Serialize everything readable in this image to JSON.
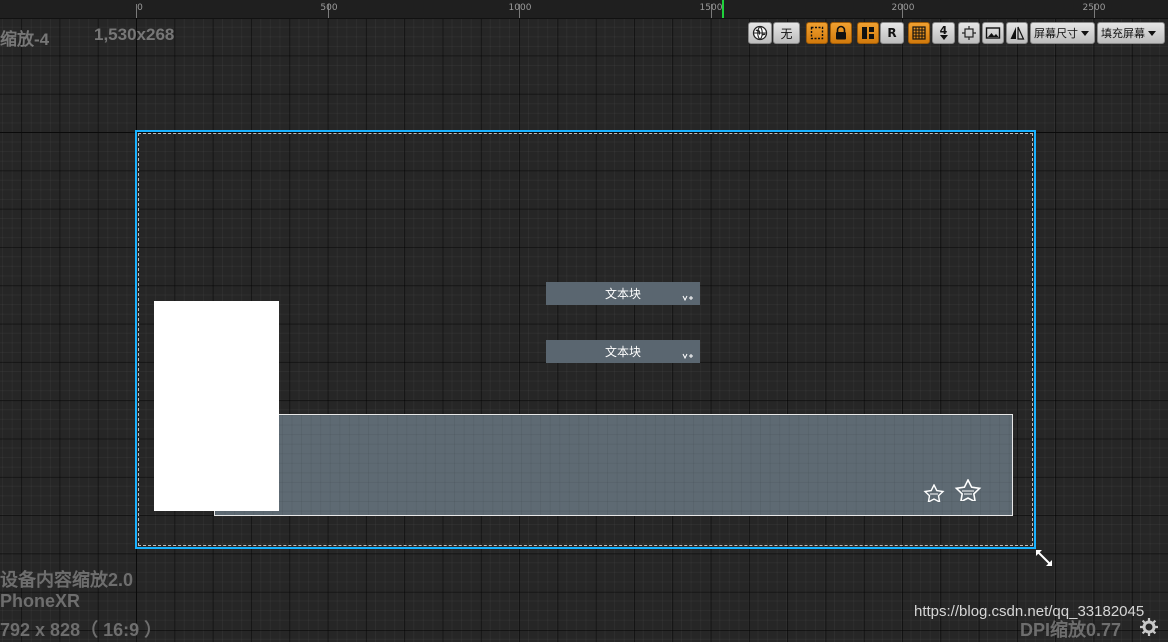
{
  "ruler": {
    "labels": [
      "0",
      "500",
      "1000",
      "1500",
      "2000",
      "2500"
    ],
    "marker_color": "#1fd13b"
  },
  "header": {
    "zoom_label": "缩放-4",
    "resolution": "1,530x268"
  },
  "toolbar": {
    "globe_icon": "globe-icon",
    "none_label": "无",
    "outline_icon": "dashed-outline-icon",
    "lock_icon": "lock-icon",
    "layout_icon": "layout-icon",
    "respect_label": "R",
    "grid_icon": "grid-icon",
    "grid_size": "4",
    "align_icon": "align-icon",
    "background_icon": "image-icon",
    "flip_icon": "flip-icon",
    "screen_size_label": "屏幕尺寸",
    "fill_screen_label": "填充屏幕",
    "accent_color": "#e0880f"
  },
  "canvas": {
    "border_color": "#1ab2ff",
    "text_blocks": [
      "文本块",
      "文本块"
    ],
    "panel_color": "#5e6a73",
    "image_color": "#ffffff",
    "stars": [
      "star-icon",
      "star-icon"
    ]
  },
  "footer": {
    "dpi_scale_label": "设备内容缩放2.0",
    "device_name": "PhoneXR",
    "device_resolution": "792 x 828（ 16:9 ）",
    "dpi_label": "DPI缩放0.77",
    "watermark": "https://blog.csdn.net/qq_33182045"
  }
}
